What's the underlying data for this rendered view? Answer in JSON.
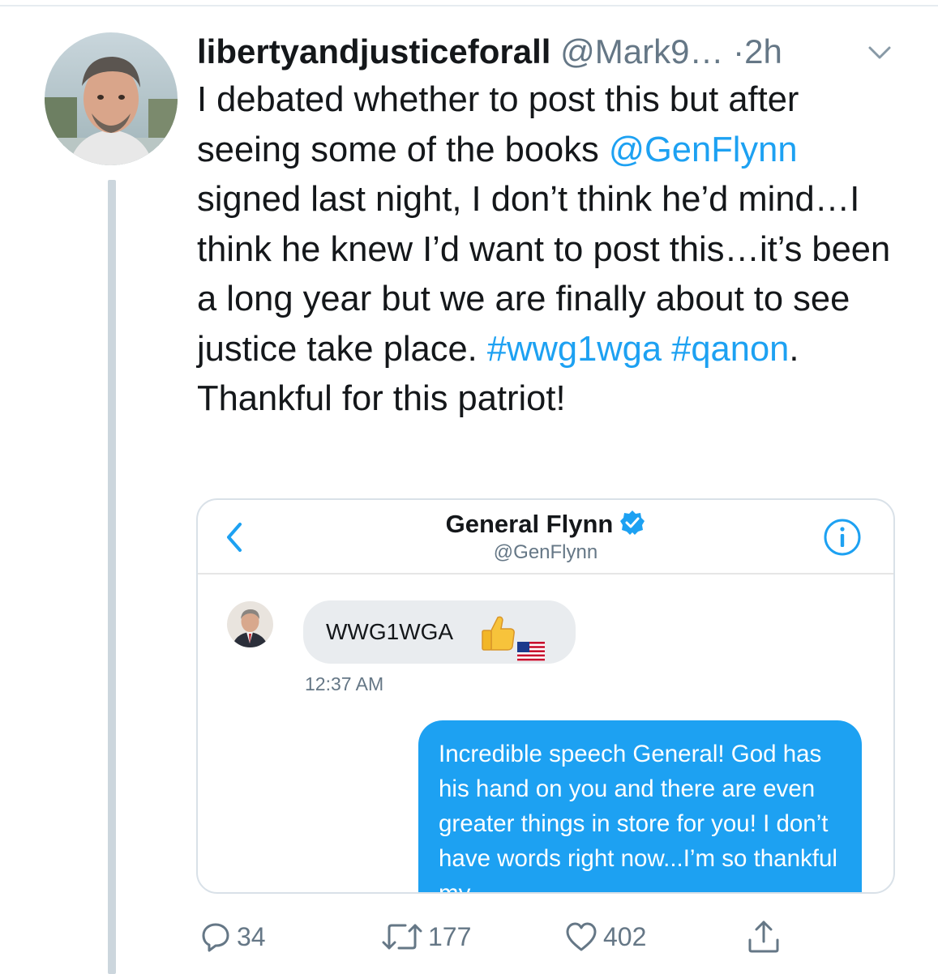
{
  "tweet": {
    "display_name": "libertyandjusticeforall",
    "handle": "@Mark9…",
    "separator": " ·",
    "time": "2h",
    "text_parts": {
      "p1": "I debated whether to post this but after seeing some of the books ",
      "mention": "@GenFlynn",
      "p2": " signed last night, I don’t think he’d mind…I think he knew I’d want to post this…it’s been a long year but we are finally about to see justice take place. ",
      "hashtag1": "#wwg1wga",
      "space": " ",
      "hashtag2": "#qanon",
      "p3": ". Thankful for this patriot!"
    },
    "avatar_icon": "user-photo",
    "caret_icon": "chevron-down-icon"
  },
  "dm_screenshot": {
    "name": "General Flynn",
    "handle": "@GenFlynn",
    "verified_icon": "verified-badge-icon",
    "incoming_message": "WWG1WGA",
    "incoming_emojis": [
      "thumbs-up",
      "us-flag"
    ],
    "incoming_time": "12:37 AM",
    "outgoing_message": "Incredible speech General! God has his hand on you and there are even greater things in store for you!  I don’t have words right now...I’m so thankful my"
  },
  "actions": {
    "reply_count": "34",
    "retweet_count": "177",
    "like_count": "402"
  },
  "colors": {
    "link": "#1da1f2",
    "thread_line": "#ccd6dd",
    "secondary_text": "#657786",
    "dm_outgoing": "#1da1f2",
    "dm_incoming": "#e9ecef"
  }
}
